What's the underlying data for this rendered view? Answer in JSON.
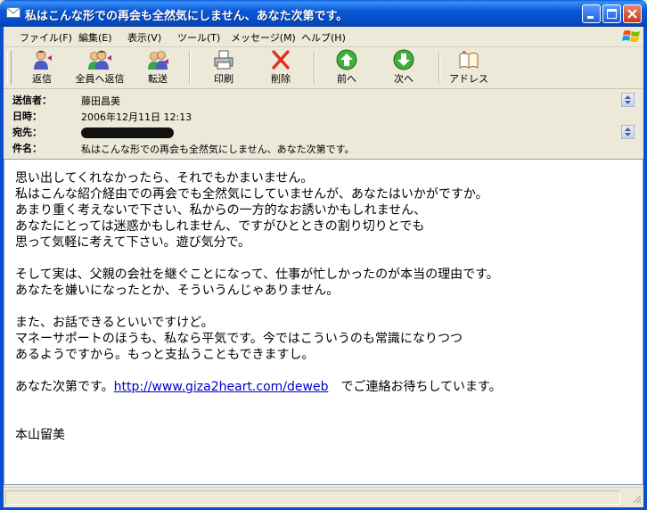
{
  "window": {
    "title": "私はこんな形での再会も全然気にしません、あなた次第です。"
  },
  "menu": {
    "items": [
      "ファイル(F)",
      "編集(E)",
      "表示(V)",
      "ツール(T)",
      "メッセージ(M)",
      "ヘルプ(H)"
    ]
  },
  "toolbar": {
    "reply": "返信",
    "reply_all": "全員へ返信",
    "forward": "転送",
    "print": "印刷",
    "delete": "削除",
    "previous": "前へ",
    "next": "次へ",
    "addresses": "アドレス"
  },
  "header": {
    "from_label": "送信者：",
    "from_value": "藤田昌美",
    "date_label": "日時：",
    "date_value": "2006年12月11日 12:13",
    "to_label": "宛先：",
    "subject_label": "件名：",
    "subject_value": "私はこんな形での再会も全然気にしません、あなた次第です。"
  },
  "message": {
    "lines": [
      "思い出してくれなかったら、それでもかまいません。",
      "私はこんな紹介経由での再会でも全然気にしていませんが、あなたはいかがですか。",
      "あまり重く考えないで下さい、私からの一方的なお誘いかもしれません、",
      "あなたにとっては迷惑かもしれません、ですがひとときの割り切りとでも",
      "思って気軽に考えて下さい。遊び気分で。",
      "",
      "そして実は、父親の会社を継ぐことになって、仕事が忙しかったのが本当の理由です。",
      "あなたを嫌いになったとか、そういうんじゃありません。",
      "",
      "また、お話できるといいですけど。",
      "マネーサポートのほうも、私なら平気です。今ではこういうのも常識になりつつ",
      "あるようですから。もっと支払うこともできますし。",
      ""
    ],
    "link_prefix": "あなた次第です。",
    "link_url": "http://www.giza2heart.com/deweb",
    "link_suffix": "　でご連絡お待ちしています。",
    "signature": "本山留美"
  }
}
